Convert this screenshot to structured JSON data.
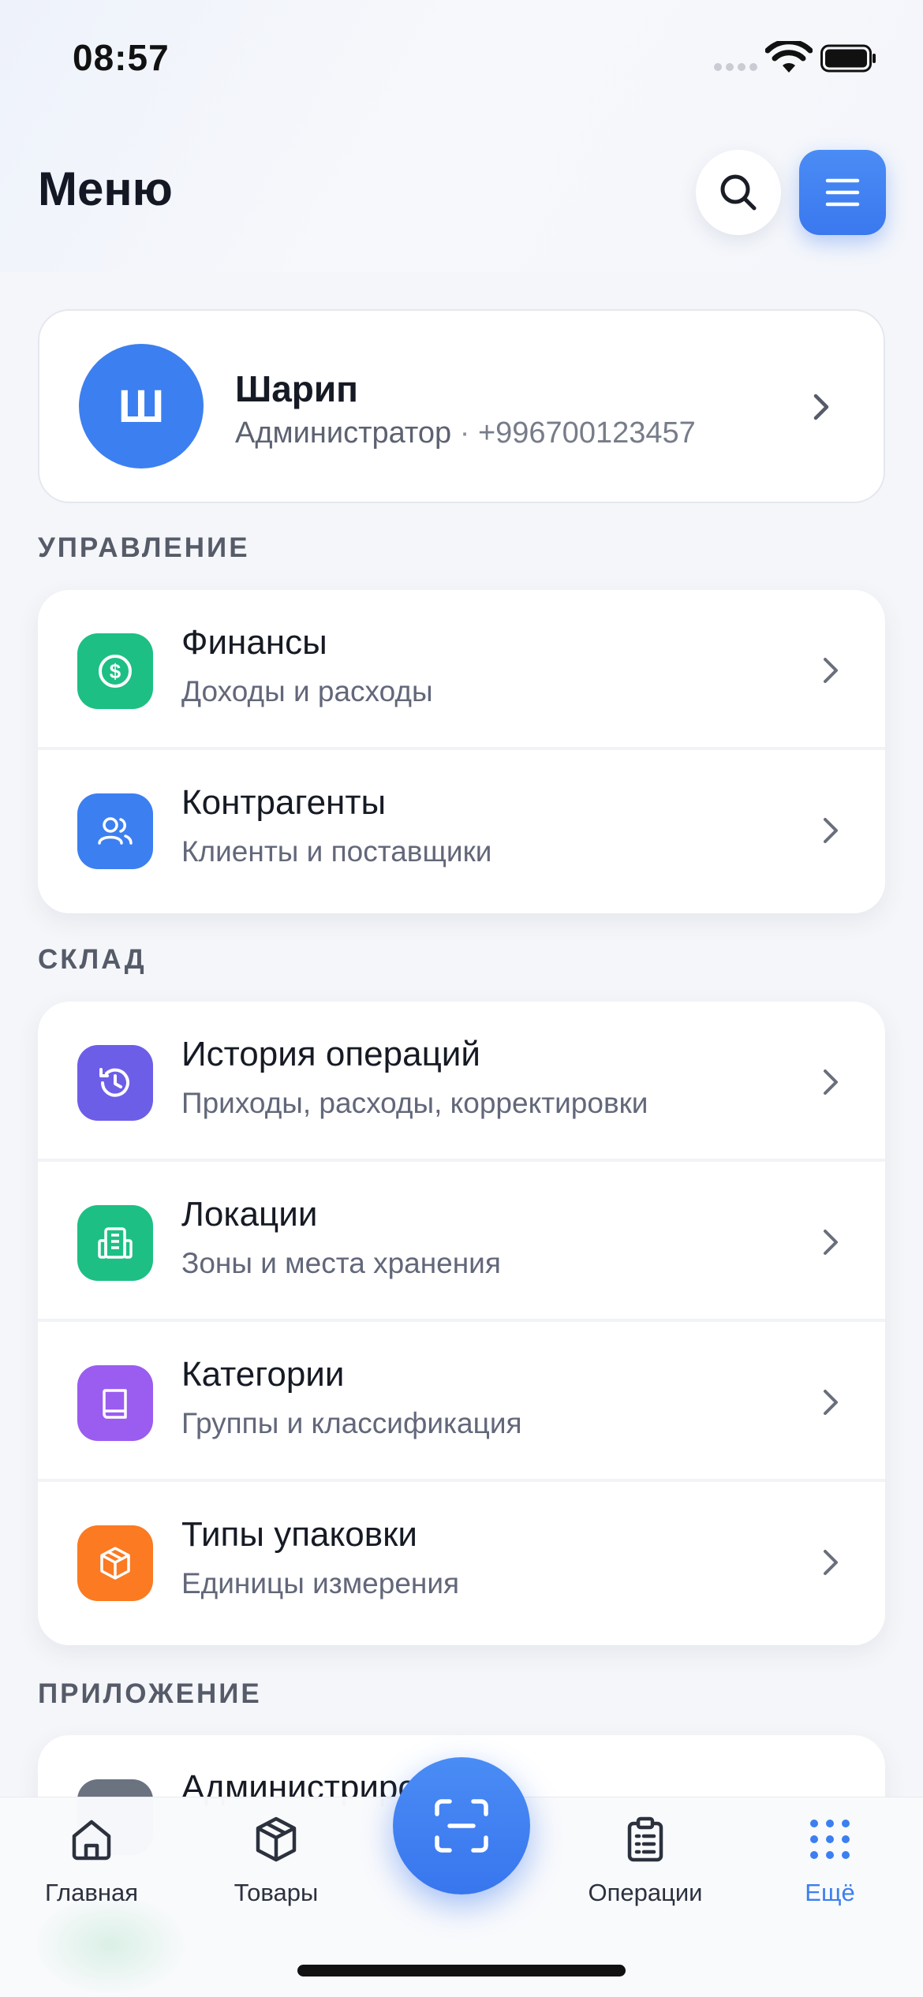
{
  "status_bar": {
    "time": "08:57"
  },
  "header": {
    "title": "Меню",
    "search_icon": "search-icon",
    "menu_icon": "menu-icon"
  },
  "profile": {
    "initial": "Ш",
    "name": "Шарип",
    "role": "Администратор",
    "separator": " · ",
    "phone": "+996700123457"
  },
  "sections": [
    {
      "label": "УПРАВЛЕНИЕ",
      "items": [
        {
          "title": "Финансы",
          "subtitle": "Доходы и расходы",
          "icon": "dollar-circle-icon",
          "color": "#1dbf84"
        },
        {
          "title": "Контрагенты",
          "subtitle": "Клиенты и поставщики",
          "icon": "users-icon",
          "color": "#3c7ff0"
        }
      ]
    },
    {
      "label": "СКЛАД",
      "items": [
        {
          "title": "История операций",
          "subtitle": "Приходы, расходы, корректировки",
          "icon": "history-icon",
          "color": "#6d5ee8"
        },
        {
          "title": "Локации",
          "subtitle": "Зоны и места хранения",
          "icon": "building-icon",
          "color": "#1dbf84"
        },
        {
          "title": "Категории",
          "subtitle": "Группы и классификация",
          "icon": "book-icon",
          "color": "#9b5cf0"
        },
        {
          "title": "Типы упаковки",
          "subtitle": "Единицы измерения",
          "icon": "package-icon",
          "color": "#fb7a22"
        }
      ]
    },
    {
      "label": "ПРИЛОЖЕНИЕ",
      "items": [
        {
          "title": "Администрирование",
          "icon": "admin-icon",
          "color": "#6b7280"
        }
      ]
    }
  ],
  "tabbar": {
    "tabs": [
      {
        "label": "Главная",
        "icon": "home-icon"
      },
      {
        "label": "Товары",
        "icon": "box-icon"
      },
      {
        "label": "Операции",
        "icon": "clipboard-icon"
      },
      {
        "label": "Ещё",
        "icon": "grid-dots-icon"
      }
    ],
    "fab_icon": "scan-icon",
    "active_color": "#3c7ff0"
  }
}
